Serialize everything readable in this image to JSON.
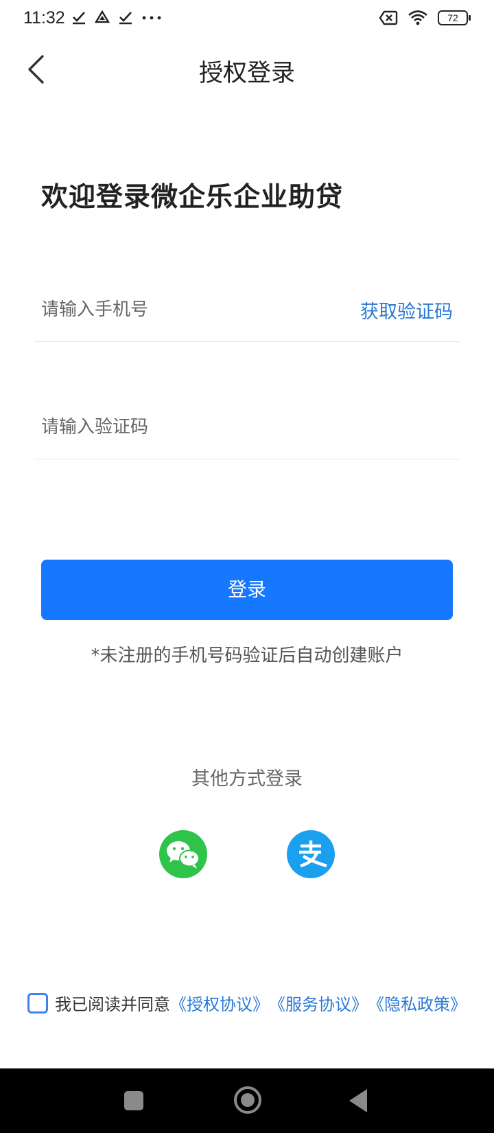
{
  "status_bar": {
    "time": "11:32",
    "battery": "72"
  },
  "header": {
    "title": "授权登录"
  },
  "welcome": "欢迎登录微企乐企业助贷",
  "form": {
    "phone_placeholder": "请输入手机号",
    "get_code_label": "获取验证码",
    "code_placeholder": "请输入验证码",
    "login_label": "登录",
    "note": "*未注册的手机号码验证后自动创建账户"
  },
  "other_login": {
    "title": "其他方式登录",
    "methods": [
      "wechat-icon",
      "alipay-icon"
    ]
  },
  "agreement": {
    "prefix": "我已阅读并同意",
    "links": [
      "《授权协议》",
      "《服务协议》",
      "《隐私政策》"
    ]
  },
  "colors": {
    "primary": "#1677ff",
    "link": "#2979d6",
    "wechat": "#2ec449",
    "alipay": "#1aa0ee"
  }
}
